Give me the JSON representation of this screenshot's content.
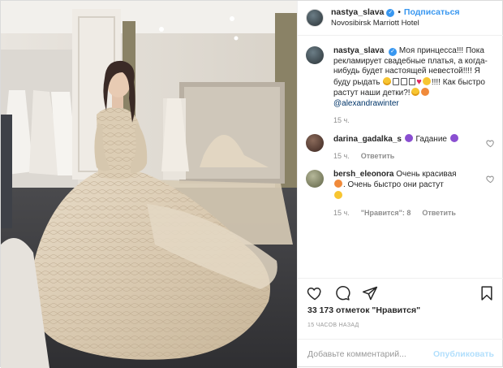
{
  "header": {
    "username": "nastya_slava",
    "follow_label": "Подписаться",
    "location": "Novosibirsk Marriott Hotel"
  },
  "caption": {
    "username": "nastya_slava",
    "text_1": "Моя принцесса!!! Пока рекламирует свадебные платья, а когда-нибудь будет настоящей невестой!!!! Я буду рыдать",
    "text_2": "!!!! Как быстро растут наши детки?!",
    "mention": "@alexandrawinter",
    "time": "15 ч."
  },
  "comments": [
    {
      "username": "darina_gadalka_s",
      "text": "Гадание",
      "time": "15 ч.",
      "reply_label": "Ответить",
      "likes_label": ""
    },
    {
      "username": "bersh_eleonora",
      "text_1": "Очень красивая",
      "text_2": ". Очень быстро они растут",
      "time": "15 ч.",
      "likes_label": "\"Нравится\": 8",
      "reply_label": "Ответить"
    }
  ],
  "likes": "33 173 отметок \"Нравится\"",
  "timestamp": "15 ЧАСОВ НАЗАД",
  "comment_input": {
    "placeholder": "Добавьте комментарий...",
    "publish_label": "Опубликовать"
  },
  "icons": [
    "heart-icon",
    "comment-icon",
    "share-icon",
    "bookmark-icon",
    "verified-icon"
  ],
  "colors": {
    "accent": "#3897f0",
    "text": "#262626",
    "muted": "#8e8e8e",
    "publish_disabled": "#b2dffc"
  }
}
